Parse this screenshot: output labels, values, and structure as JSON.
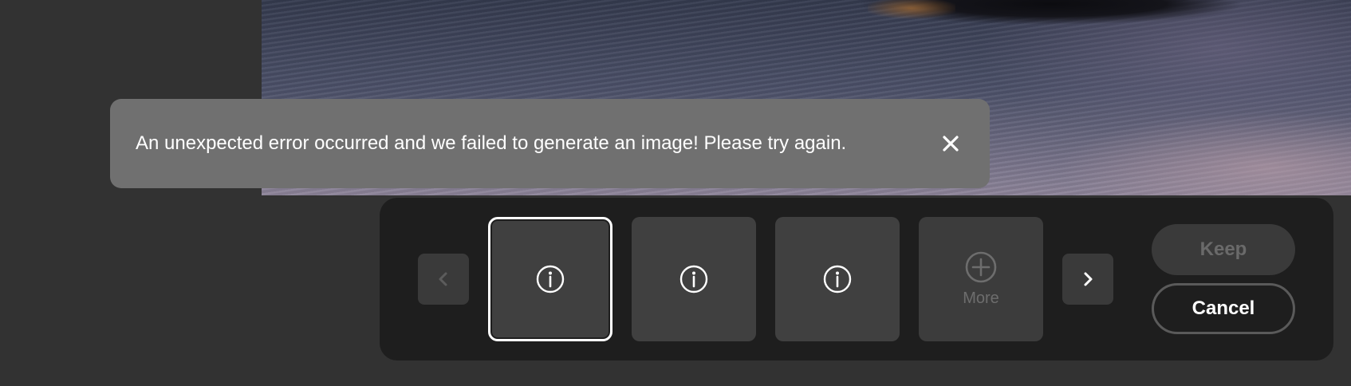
{
  "toast": {
    "message": "An unexpected error occurred and we failed to generate an image! Please try again.",
    "close_icon": "close-icon"
  },
  "variations": {
    "prev_icon": "chevron-left-icon",
    "next_icon": "chevron-right-icon",
    "thumbnails": [
      {
        "icon": "info-icon",
        "selected": true
      },
      {
        "icon": "info-icon",
        "selected": false
      },
      {
        "icon": "info-icon",
        "selected": false
      }
    ],
    "more": {
      "icon": "plus-circle-icon",
      "label": "More"
    }
  },
  "actions": {
    "keep_label": "Keep",
    "cancel_label": "Cancel"
  },
  "colors": {
    "background": "#323232",
    "toast_bg": "#707070",
    "panel_bg": "#1e1e1e",
    "thumb_bg": "#404040",
    "disabled_text": "#6a6a6a"
  }
}
